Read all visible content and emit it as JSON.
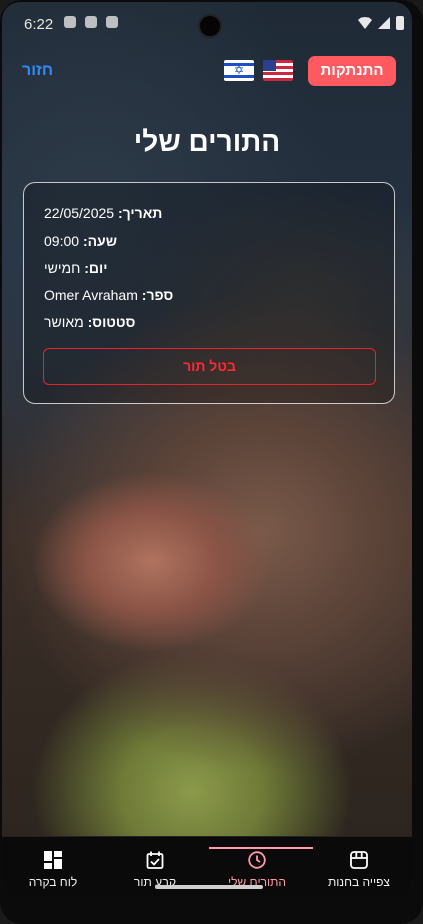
{
  "status_bar": {
    "time": "6:22"
  },
  "header": {
    "back_label": "חזור",
    "logout_label": "התנתקות",
    "flags": [
      "israel-flag-icon",
      "usa-flag-icon"
    ]
  },
  "page": {
    "title": "התורים שלי"
  },
  "appointment": {
    "date_label": "תאריך:",
    "date_value": "22/05/2025",
    "time_label": "שעה:",
    "time_value": "09:00",
    "day_label": "יום:",
    "day_value": "חמישי",
    "barber_label": "ספר:",
    "barber_value": "Omer Avraham",
    "status_label": "סטטוס:",
    "status_value": "מאושר",
    "cancel_label": "בטל תור"
  },
  "nav": {
    "items": [
      {
        "label": "לוח בקרה",
        "icon": "dashboard-icon"
      },
      {
        "label": "קבע תור",
        "icon": "calendar-check-icon"
      },
      {
        "label": "התורים שלי",
        "icon": "clock-icon",
        "active": true
      },
      {
        "label": "צפייה בחנות",
        "icon": "store-icon"
      }
    ]
  },
  "colors": {
    "accent": "#ff5a5f",
    "link": "#2f8cff",
    "cancel": "#e8222a",
    "active_nav": "#ff9aa8"
  }
}
